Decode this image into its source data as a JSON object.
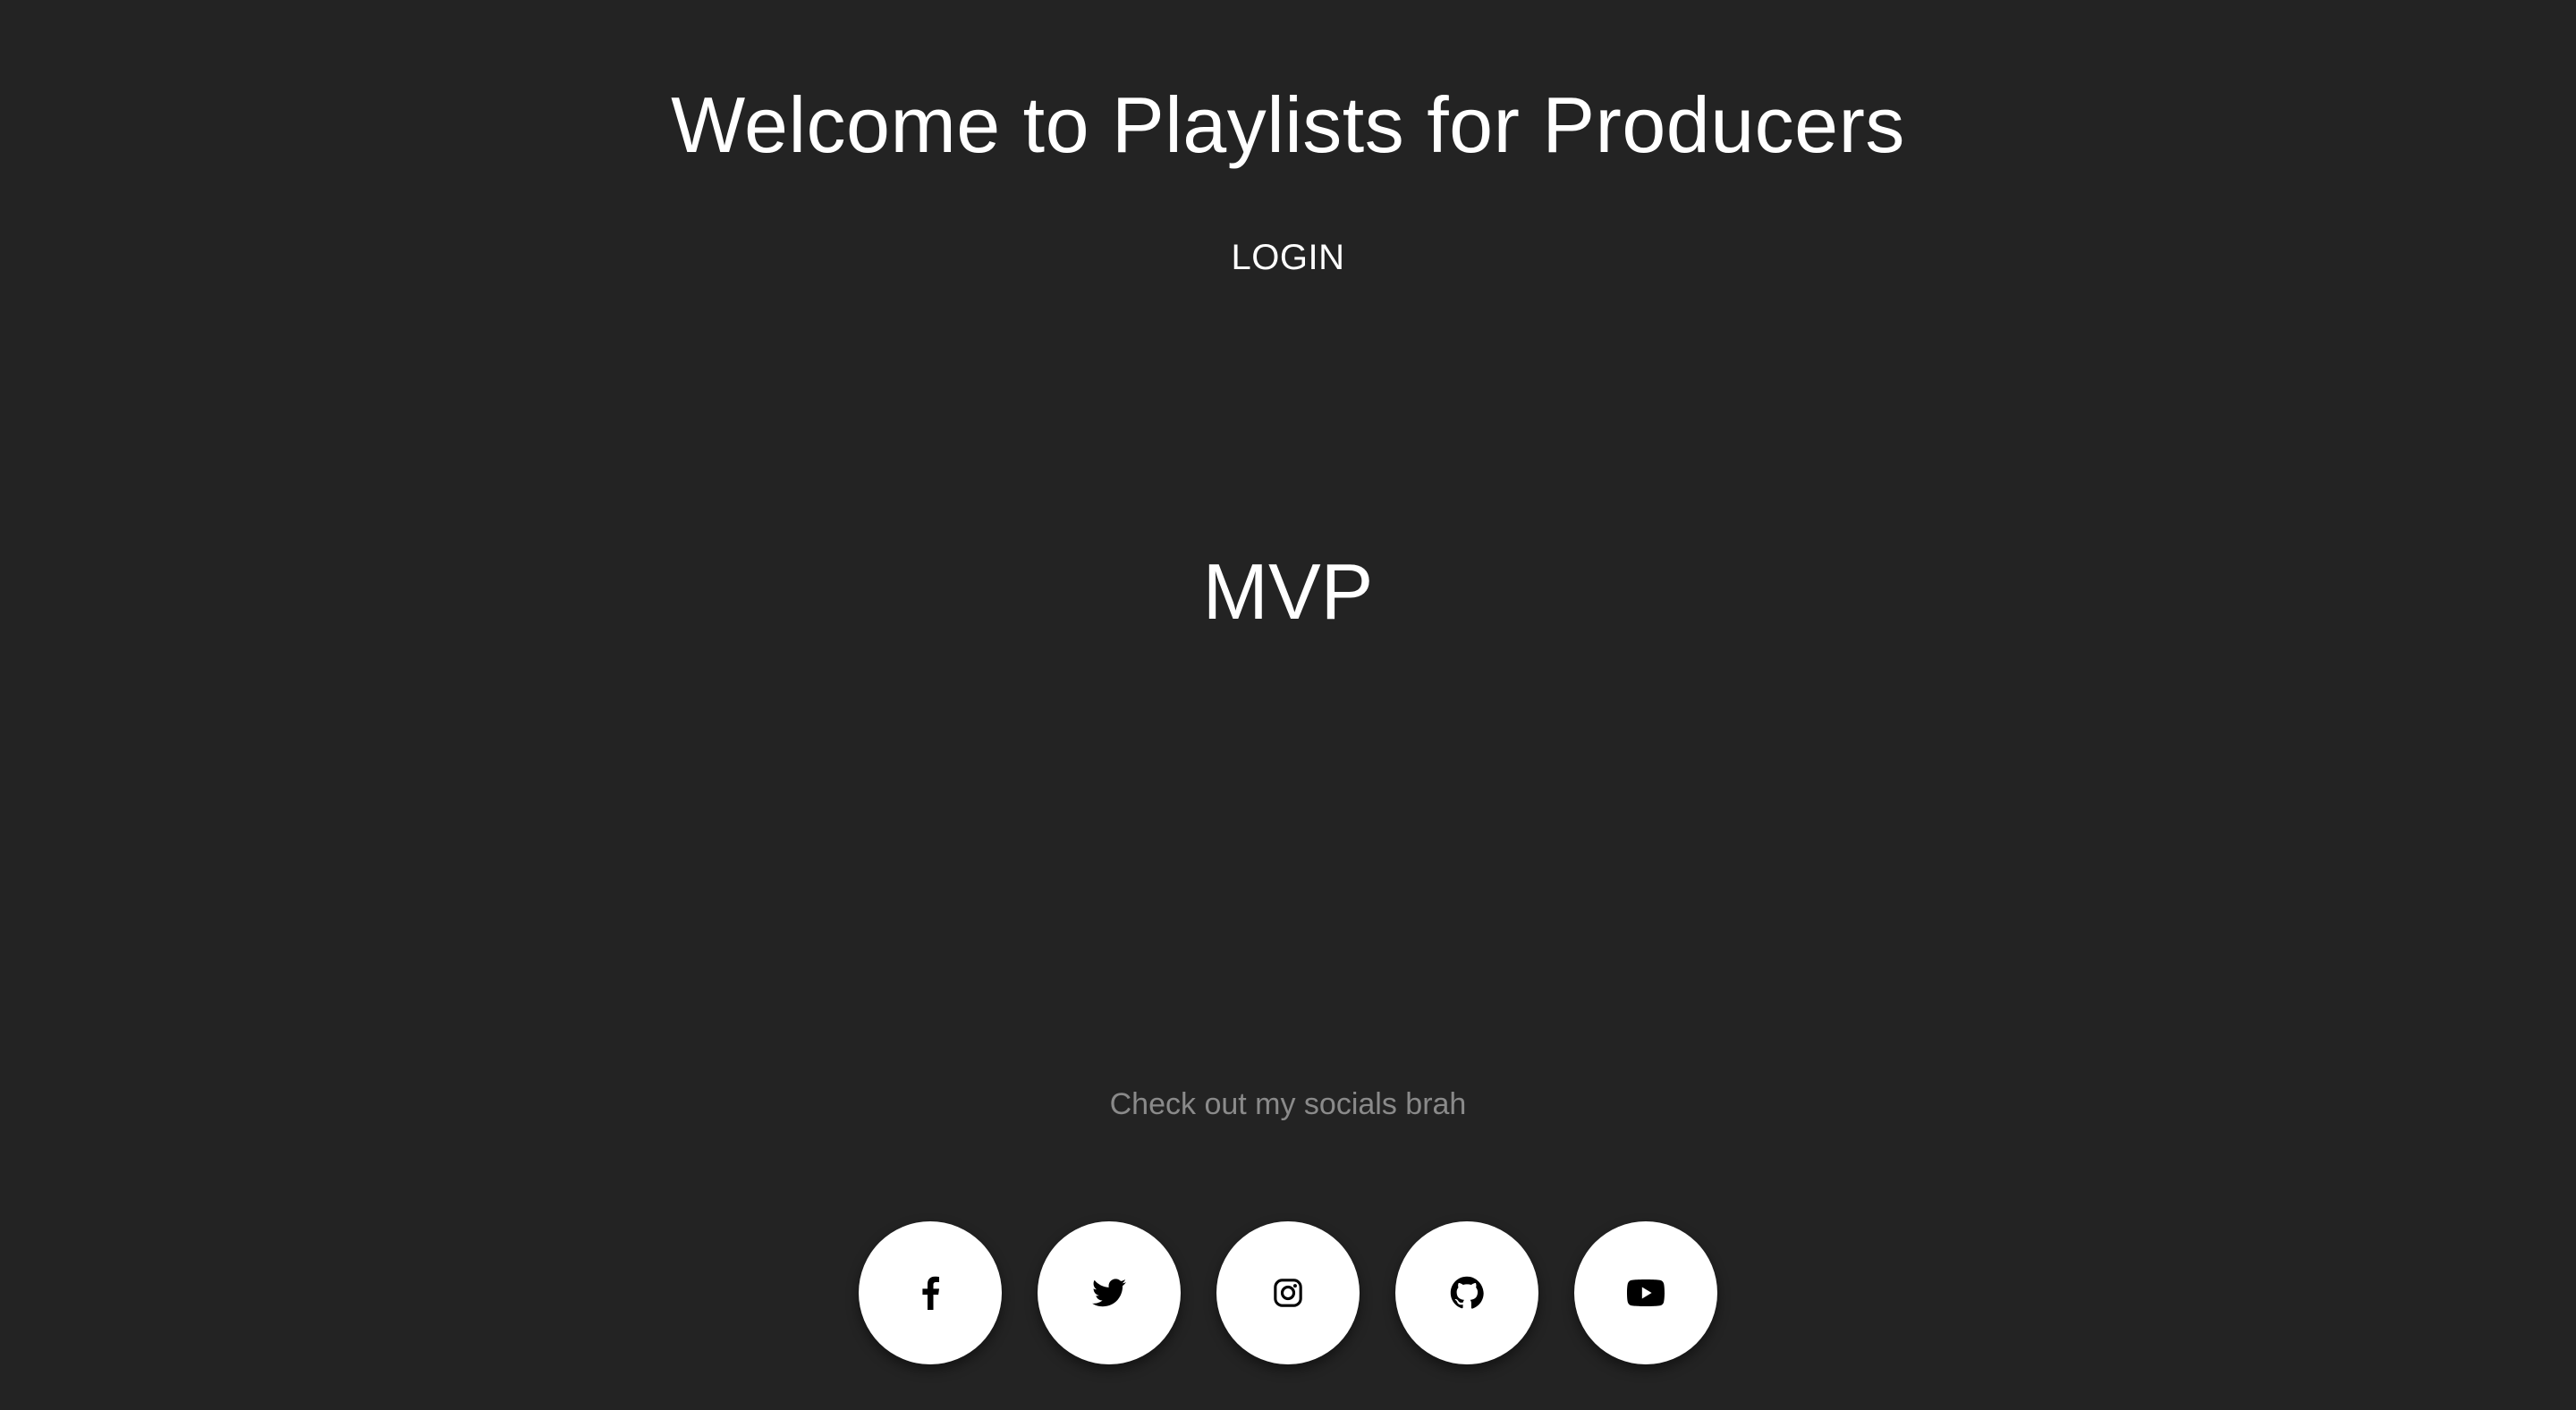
{
  "header": {
    "title": "Welcome to Playlists for Producers",
    "login_label": "LOGIN"
  },
  "main": {
    "heading": "MVP"
  },
  "footer": {
    "socials_text": "Check out my socials brah",
    "socials": [
      {
        "name": "facebook",
        "icon": "facebook-icon"
      },
      {
        "name": "twitter",
        "icon": "twitter-icon"
      },
      {
        "name": "instagram",
        "icon": "instagram-icon"
      },
      {
        "name": "github",
        "icon": "github-icon"
      },
      {
        "name": "youtube",
        "icon": "youtube-icon"
      }
    ]
  },
  "colors": {
    "background": "#232323",
    "text": "#ffffff",
    "muted": "#8a8a8a",
    "social_bg": "#ffffff",
    "social_icon": "#000000"
  }
}
